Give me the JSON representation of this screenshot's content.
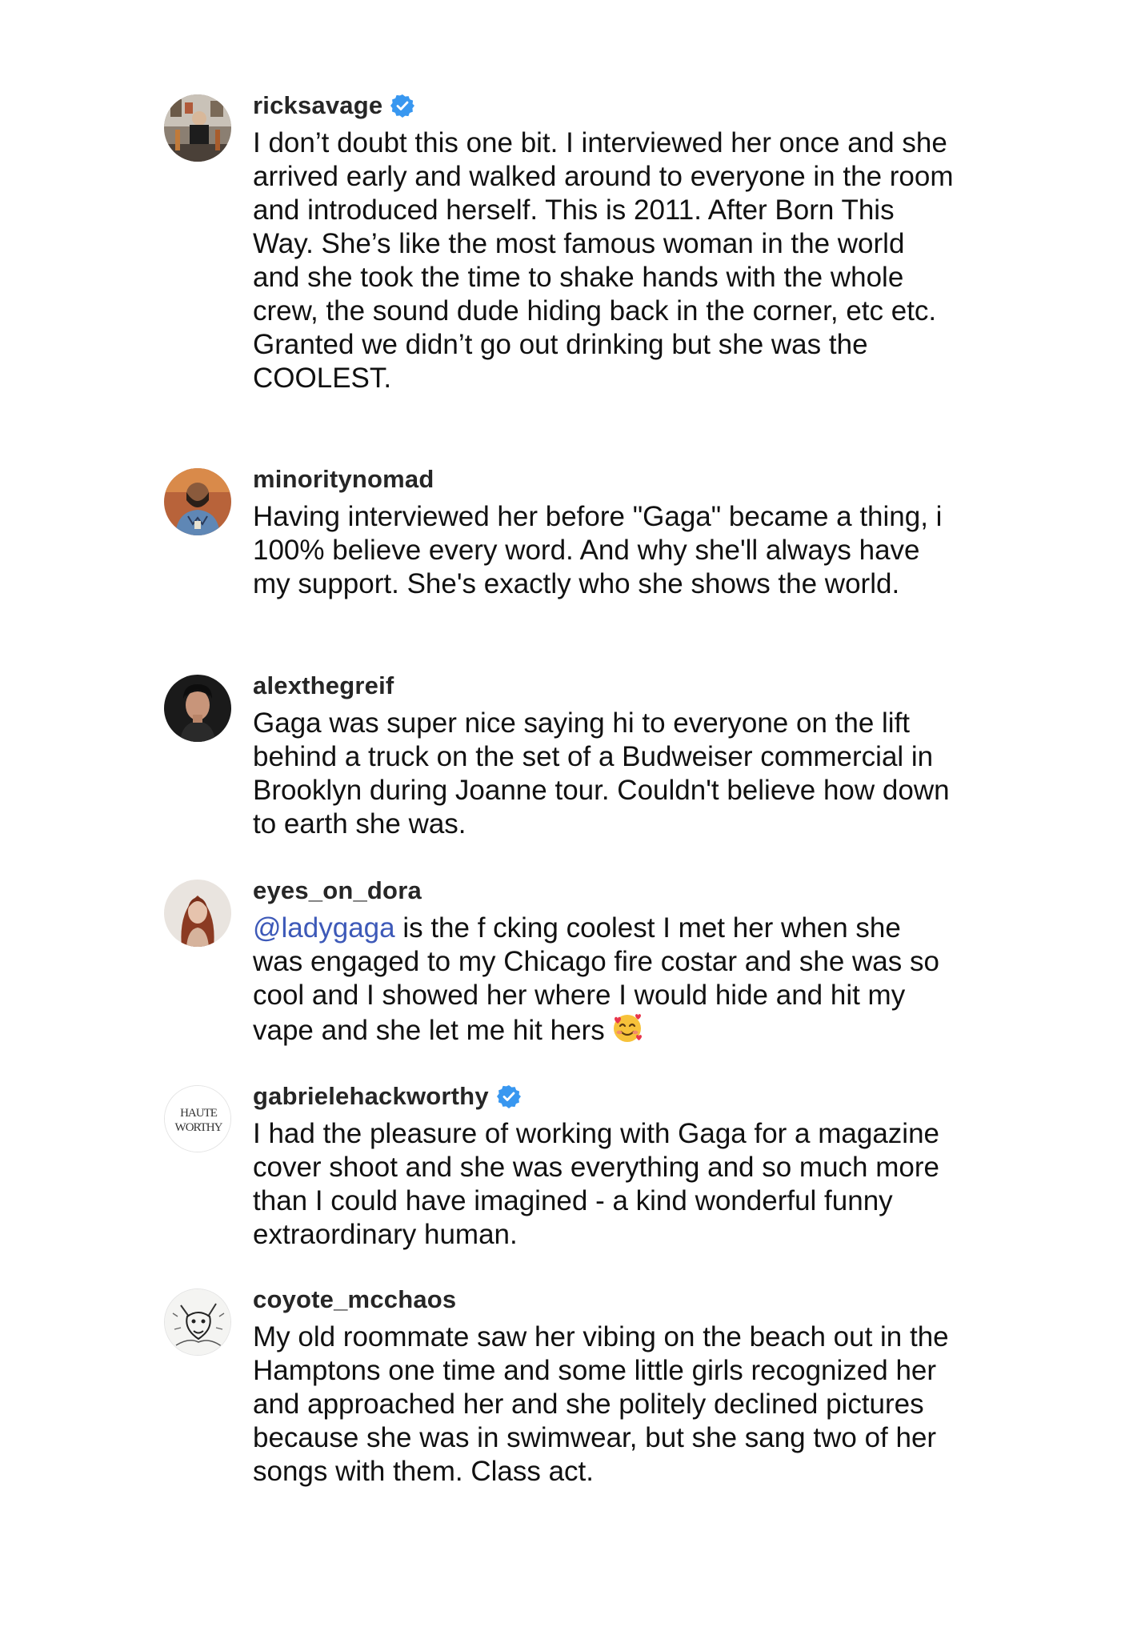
{
  "comments": [
    {
      "username": "ricksavage",
      "verified": true,
      "avatar": "photo-man-guitars",
      "text": "I don’t doubt this one bit. I interviewed her once and she arrived early and walked around to everyone in the room and introduced herself. This is 2011. After Born This Way. She’s like the most famous woman in the world and she took the time to shake hands with the whole crew, the sound dude hiding back in the corner, etc etc. Granted we didn’t go out drinking but she was the COOLEST."
    },
    {
      "username": "minoritynomad",
      "verified": false,
      "avatar": "photo-man-shirt",
      "text": "Having interviewed her before \"Gaga\" became a thing, i 100% believe every word. And why she'll always have my support. She's exactly who she shows the world."
    },
    {
      "username": "alexthegreif",
      "verified": false,
      "avatar": "photo-man-portrait",
      "text": "Gaga was super nice saying hi to everyone on the lift behind a truck on the set of a Budweiser commercial in Brooklyn during Joanne tour. Couldn't believe how down to earth she was."
    },
    {
      "username": "eyes_on_dora",
      "verified": false,
      "avatar": "photo-woman-redhair",
      "mention": "@ladygaga",
      "text": " is the f  cking coolest I met her when she was engaged to my Chicago fire costar and she was so cool and I showed her where I would hide and hit my vape and she let me hit hers",
      "emoji": "smiling-face-with-hearts"
    },
    {
      "username": "gabrielehackworthy",
      "verified": true,
      "avatar": "haute-worthy-logo",
      "avatar_text": "HAUTE WORTHY",
      "text": "I had the pleasure of working with  Gaga for a magazine cover shoot and she was everything and so much more than I could have imagined - a kind wonderful funny extraordinary human."
    },
    {
      "username": "coyote_mcchaos",
      "verified": false,
      "avatar": "sketch-coyote",
      "text": "My old roommate saw her vibing on the beach out in the Hamptons one time and some little girls recognized her and approached her and she politely declined pictures because she was in swimwear, but she sang two of her songs with them. Class act."
    }
  ],
  "colors": {
    "username": "#262626",
    "text": "#111111",
    "mention": "#3d59b8",
    "verified": "#3897f0"
  }
}
